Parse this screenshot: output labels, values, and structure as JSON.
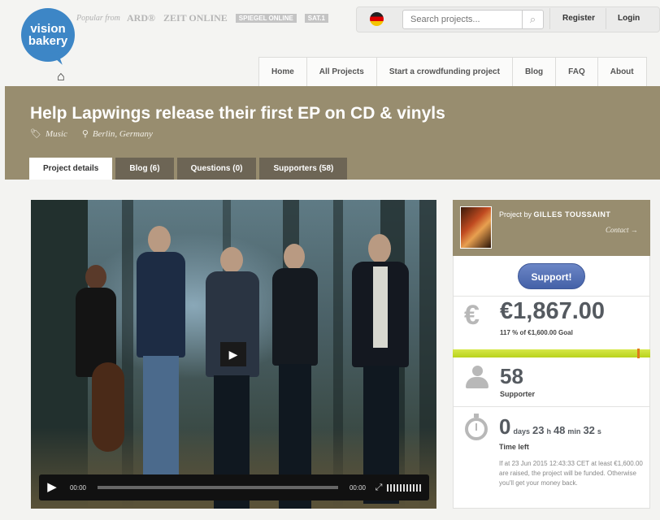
{
  "logo": {
    "text": "vision bakery"
  },
  "press": {
    "intro": "Popular from",
    "outlets": [
      "ARD®",
      "ZEIT ONLINE",
      "SPIEGEL ONLINE",
      "SAT.1"
    ]
  },
  "top_links": {
    "register": "Register",
    "login": "Login"
  },
  "search": {
    "placeholder": "Search projects..."
  },
  "nav": [
    "Home",
    "All Projects",
    "Start a crowdfunding project",
    "Blog",
    "FAQ",
    "About"
  ],
  "project": {
    "title": "Help Lapwings release their first EP on CD & vinyls",
    "category": "Music",
    "location": "Berlin, Germany"
  },
  "tabs": [
    "Project details",
    "Blog (6)",
    "Questions (0)",
    "Supporters (58)"
  ],
  "video": {
    "current_time": "00:00",
    "duration": "00:00"
  },
  "creator": {
    "prefix": "Project by",
    "name": "GILLES TOUSSAINT",
    "contact": "Contact →"
  },
  "support_button": "Support!",
  "funding": {
    "currency_symbol": "€",
    "amount": "€1,867.00",
    "goal_text": "117 % of €1,600.00 Goal",
    "progress_fraction": 1.0
  },
  "supporters": {
    "count": "58",
    "label": "Supporter"
  },
  "time_left": {
    "days": "0",
    "days_unit": "days",
    "hours": "23",
    "hours_unit": "h",
    "minutes": "48",
    "minutes_unit": "min",
    "seconds": "32",
    "seconds_unit": "s",
    "label": "Time left",
    "note": "If at 23 Jun 2015 12:43:33 CET at least €1,600.00 are raised, the project will be funded. Otherwise you'll get your money back."
  },
  "colors": {
    "banner": "#988d6f",
    "brand_blue": "#3d86c6",
    "support_button": "#4a67ae",
    "progress": "#c5dc2a"
  }
}
